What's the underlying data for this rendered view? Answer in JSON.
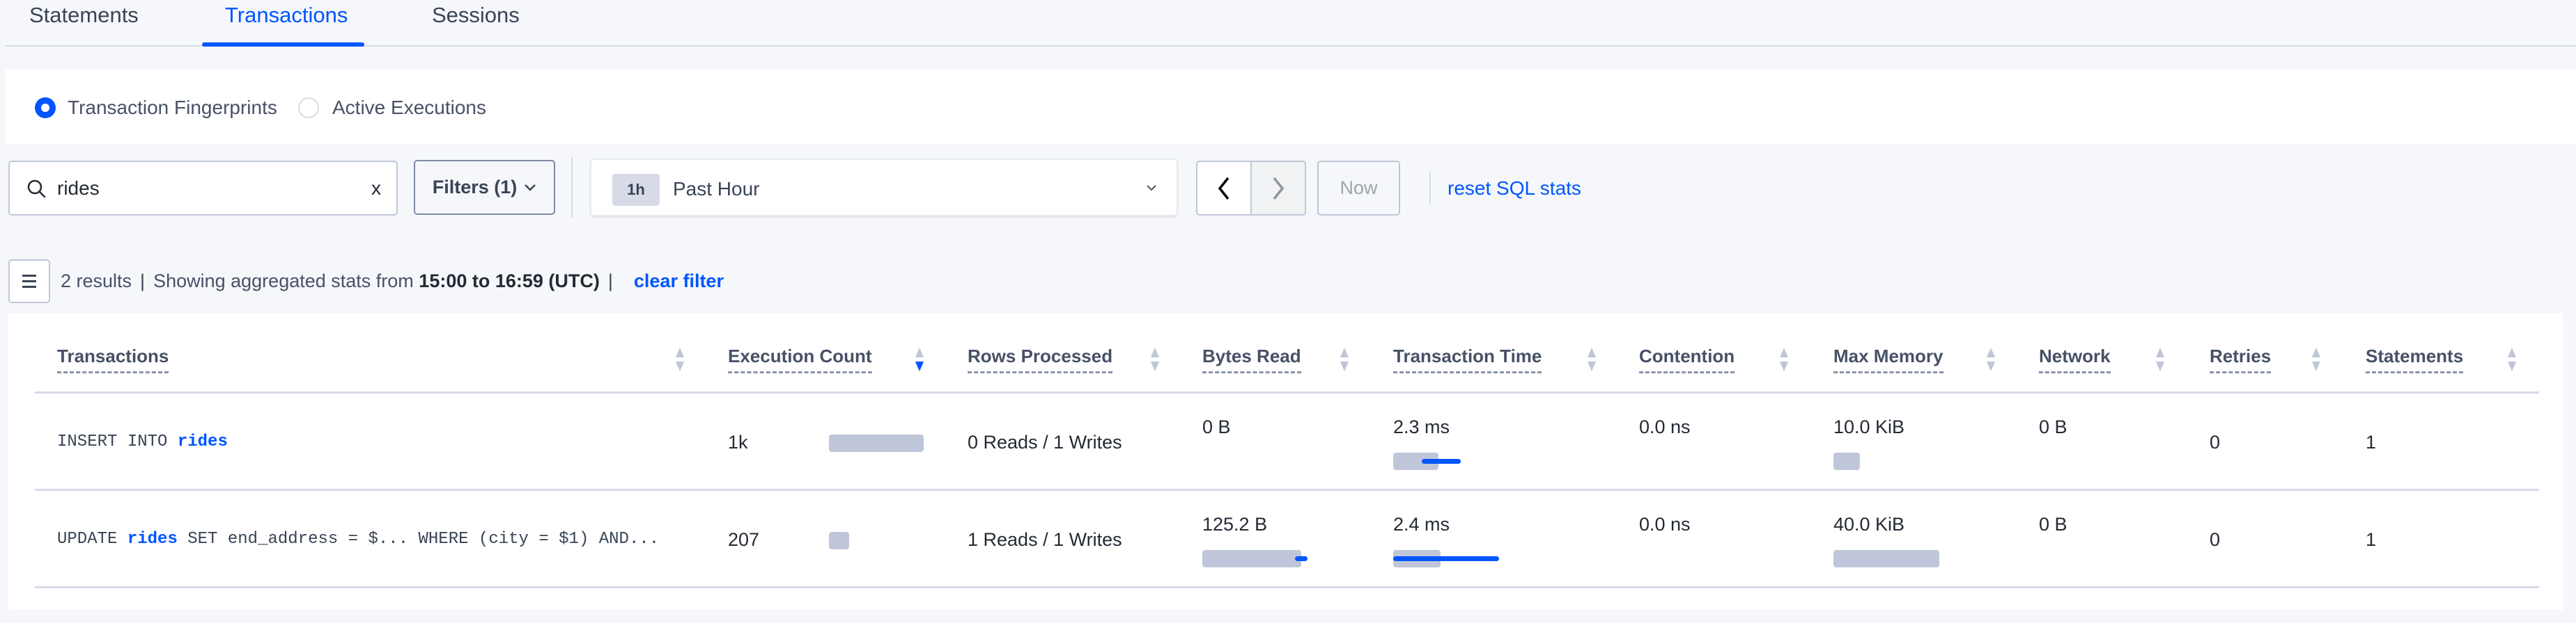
{
  "tabs": [
    {
      "label": "Statements",
      "active": false
    },
    {
      "label": "Transactions",
      "active": true
    },
    {
      "label": "Sessions",
      "active": false
    }
  ],
  "view_mode": {
    "options": [
      {
        "label": "Transaction Fingerprints",
        "checked": true
      },
      {
        "label": "Active Executions",
        "checked": false
      }
    ]
  },
  "search": {
    "value": "rides",
    "icon": "search-icon",
    "clear_icon": "close-icon",
    "clear_glyph": "x"
  },
  "filters": {
    "label": "Filters (1)",
    "icon": "chevron-down-icon"
  },
  "time_range": {
    "badge": "1h",
    "label": "Past Hour",
    "icon": "chevron-down-icon"
  },
  "pager": {
    "prev_icon": "chevron-left-icon",
    "next_icon": "chevron-right-icon",
    "now_label": "Now"
  },
  "reset_label": "reset SQL stats",
  "results": {
    "count_text": "2 results",
    "prefix": "Showing aggregated stats from",
    "range": "15:00 to 16:59 (UTC)",
    "clear_filter": "clear filter"
  },
  "colors": {
    "accent": "#0055ff",
    "bar": "#c0c6d9",
    "text": "#394455",
    "background": "#f5f7fa"
  },
  "table": {
    "columns": [
      {
        "label": "Transactions",
        "sort": "none"
      },
      {
        "label": "Execution Count",
        "sort": "desc"
      },
      {
        "label": "Rows Processed",
        "sort": "none"
      },
      {
        "label": "Bytes Read",
        "sort": "none"
      },
      {
        "label": "Transaction Time",
        "sort": "none"
      },
      {
        "label": "Contention",
        "sort": "none"
      },
      {
        "label": "Max Memory",
        "sort": "none"
      },
      {
        "label": "Network",
        "sort": "none"
      },
      {
        "label": "Retries",
        "sort": "none"
      },
      {
        "label": "Statements",
        "sort": "none"
      }
    ],
    "rows": [
      {
        "txn_parts": [
          {
            "text": "INSERT INTO ",
            "hl": false
          },
          {
            "text": "rides",
            "hl": true
          }
        ],
        "exec_count": "1k",
        "exec_bar": 1.0,
        "rows_processed": "0 Reads / 1 Writes",
        "bytes_read": "0 B",
        "bytes_bar": null,
        "bytes_dev": null,
        "txn_time": "2.3 ms",
        "txn_time_bar": 0.43,
        "txn_time_dev": [
          0.27,
          0.64
        ],
        "contention": "0.0 ns",
        "max_memory": "10.0 KiB",
        "memory_bar": 0.25,
        "network": "0 B",
        "retries": "0",
        "statements": "1"
      },
      {
        "txn_parts": [
          {
            "text": "UPDATE ",
            "hl": false
          },
          {
            "text": "rides",
            "hl": true
          },
          {
            "text": " SET end_address = $... WHERE (city = $1) AND...",
            "hl": false
          }
        ],
        "exec_count": "207",
        "exec_bar": 0.21,
        "rows_processed": "1 Reads / 1 Writes",
        "bytes_read": "125.2 B",
        "bytes_bar": 1.0,
        "bytes_dev": [
          0.94,
          1.06
        ],
        "txn_time": "2.4 ms",
        "txn_time_bar": 0.45,
        "txn_time_dev": [
          0.0,
          1.0
        ],
        "contention": "0.0 ns",
        "max_memory": "40.0 KiB",
        "memory_bar": 1.0,
        "network": "0 B",
        "retries": "0",
        "statements": "1"
      }
    ]
  }
}
